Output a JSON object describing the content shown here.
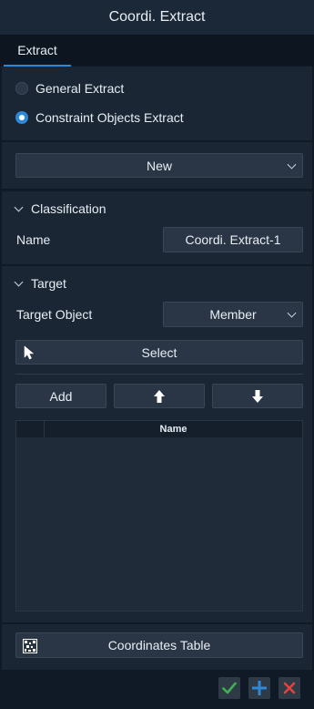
{
  "window": {
    "title": "Coordi. Extract"
  },
  "tabs": [
    {
      "label": "Extract",
      "active": true
    }
  ],
  "extract_mode": {
    "options": [
      {
        "label": "General Extract",
        "selected": false
      },
      {
        "label": "Constraint Objects Extract",
        "selected": true
      }
    ]
  },
  "template_select": {
    "value": "New"
  },
  "classification": {
    "header": "Classification",
    "name_label": "Name",
    "name_value": "Coordi. Extract-1"
  },
  "target": {
    "header": "Target",
    "object_label": "Target Object",
    "object_value": "Member",
    "select_button": "Select",
    "add_button": "Add",
    "table": {
      "columns": [
        "Name"
      ],
      "rows": []
    }
  },
  "coordinates_table_button": "Coordinates Table",
  "footer": {
    "ok": "check-icon",
    "add": "plus-icon",
    "cancel": "close-icon"
  },
  "colors": {
    "accent": "#2d88d8",
    "ok": "#3fb24f",
    "cancel": "#e0443c"
  }
}
